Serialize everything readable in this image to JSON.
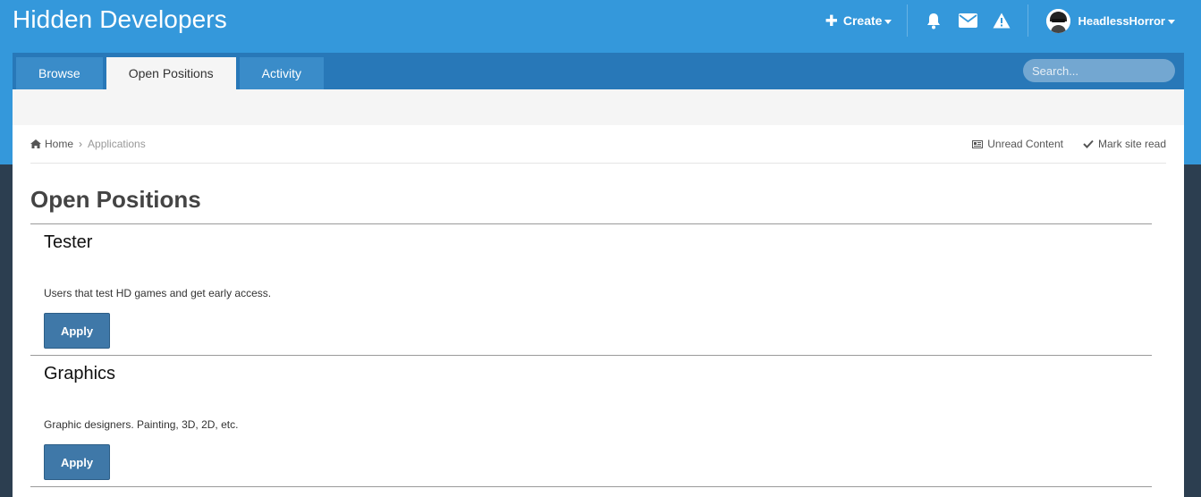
{
  "header": {
    "site_title": "Hidden Developers",
    "create_label": "Create",
    "username": "HeadlessHorror"
  },
  "nav": {
    "tabs": [
      {
        "label": "Browse",
        "active": false
      },
      {
        "label": "Open Positions",
        "active": true
      },
      {
        "label": "Activity",
        "active": false
      }
    ],
    "search_placeholder": "Search..."
  },
  "breadcrumb": {
    "home": "Home",
    "current": "Applications"
  },
  "site_actions": {
    "unread": "Unread Content",
    "mark_read": "Mark site read"
  },
  "page": {
    "title": "Open Positions"
  },
  "positions": [
    {
      "title": "Tester",
      "description": "Users that test HD games and get early access.",
      "button": "Apply"
    },
    {
      "title": "Graphics",
      "description": "Graphic designers. Painting, 3D, 2D, etc.",
      "button": "Apply"
    }
  ],
  "colors": {
    "header_bg": "#3498db",
    "nav_bg": "#2878b8",
    "tab_bg": "#3a8cc9",
    "button_bg": "#3f78a8",
    "page_bg": "#2c3e50"
  },
  "icons": [
    "plus-icon",
    "bell-icon",
    "envelope-icon",
    "warning-icon",
    "home-icon",
    "search-icon",
    "newspaper-icon",
    "check-icon"
  ]
}
